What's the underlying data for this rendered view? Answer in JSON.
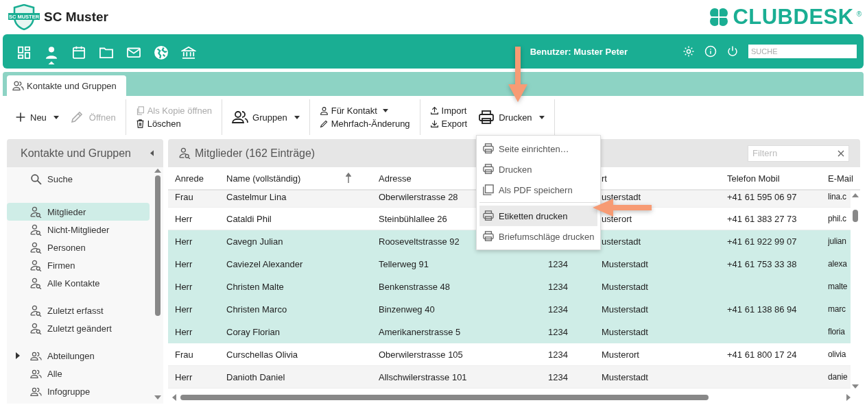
{
  "header": {
    "club_name": "SC Muster",
    "logo_text": "SC MUSTER",
    "brand": "CLUBDESK",
    "brand_mark": "®"
  },
  "nav": {
    "items": [
      {
        "selected": false
      },
      {
        "selected": true
      },
      {
        "selected": false
      },
      {
        "selected": false
      },
      {
        "selected": false
      },
      {
        "selected": false
      },
      {
        "selected": false
      }
    ],
    "user": "Benutzer: Muster Peter",
    "search": {
      "placeholder": "SUCHE"
    }
  },
  "tabs": [
    {
      "label": "Kontakte und Gruppen",
      "selected": true
    }
  ],
  "toolbar": {
    "new": {
      "label": "Neu",
      "disabled": false
    },
    "open": {
      "label": "Öffnen",
      "disabled": true
    },
    "copy": {
      "label": "Als Kopie öffnen",
      "disabled": true
    },
    "delete": {
      "label": "Löschen",
      "disabled": false
    },
    "groups": {
      "label": "Gruppen",
      "disabled": false
    },
    "for_contact": {
      "label": "Für Kontakt",
      "disabled": false
    },
    "bulk_edit": {
      "label": "Mehrfach-Änderung",
      "disabled": false
    },
    "import": {
      "label": "Import",
      "disabled": false
    },
    "export": {
      "label": "Export",
      "disabled": false
    },
    "print": {
      "label": "Drucken",
      "disabled": false
    }
  },
  "sidebar": {
    "title": "Kontakte und Gruppen",
    "sections": [
      [
        {
          "kind": "search",
          "label": "Suche",
          "selected": false
        }
      ],
      [
        {
          "kind": "filter",
          "label": "Mitglieder",
          "selected": true
        },
        {
          "kind": "filter",
          "label": "Nicht-Mitglieder",
          "selected": false
        },
        {
          "kind": "filter",
          "label": "Personen",
          "selected": false
        },
        {
          "kind": "filter",
          "label": "Firmen",
          "selected": false
        },
        {
          "kind": "filter",
          "label": "Alle Kontakte",
          "selected": false
        }
      ],
      [
        {
          "kind": "filter",
          "label": "Zuletzt erfasst",
          "selected": false
        },
        {
          "kind": "filter",
          "label": "Zuletzt geändert",
          "selected": false
        }
      ],
      [
        {
          "kind": "group",
          "label": "Abteilungen",
          "selected": false,
          "expanded": false
        },
        {
          "kind": "group",
          "label": "Alle",
          "selected": false
        },
        {
          "kind": "group",
          "label": "Infogruppe",
          "selected": false
        }
      ]
    ]
  },
  "list": {
    "title": "Mitglieder (162 Einträge)",
    "filter": {
      "placeholder": "Filtern"
    },
    "columns": [
      "Anrede",
      "Name (vollständig)",
      "Adresse",
      "",
      "rt",
      "Telefon Mobil",
      "E-Mail"
    ],
    "rows": [
      {
        "salutation": "Frau",
        "name": "Castelmur Lina",
        "address": "Oberwilerstrasse 28",
        "city": "usterstadt",
        "phone": "+41 61 595 06 97",
        "email": "lina.c",
        "selected": false
      },
      {
        "salutation": "Herr",
        "name": "Cataldi Phil",
        "address": "Steinbühlallee 26",
        "city": "usterort",
        "phone": "+41 61 383 27 73",
        "email": "phil.c",
        "selected": false
      },
      {
        "salutation": "Herr",
        "name": "Cavegn Julian",
        "address": "Rooseveltstrasse 92",
        "city": "usterstadt",
        "phone": "+41 61 922 99 07",
        "email": "julian",
        "selected": true
      },
      {
        "salutation": "Herr",
        "name": "Caviezel Alexander",
        "address": "Tellerweg 91",
        "zip": "1234",
        "city": "Musterstadt",
        "phone": "+41 61 753 33 38",
        "email": "alexa",
        "selected": true
      },
      {
        "salutation": "Herr",
        "name": "Christen Malte",
        "address": "Benkenstrasse 48",
        "zip": "1234",
        "city": "Musterstadt",
        "email": "malte",
        "selected": true
      },
      {
        "salutation": "Herr",
        "name": "Christen Marco",
        "address": "Binzenweg 40",
        "zip": "1234",
        "city": "Musterstadt",
        "phone": "+41 61 138 86 94",
        "email": "marc",
        "selected": true
      },
      {
        "salutation": "Herr",
        "name": "Coray Florian",
        "address": "Amerikanerstrasse 5",
        "zip": "1234",
        "city": "Musterstadt",
        "email": "floria",
        "selected": true
      },
      {
        "salutation": "Frau",
        "name": "Curschellas Olivia",
        "address": "Oberwilerstrasse 105",
        "zip": "1234",
        "city": "Musterort",
        "phone": "+41 61 800 17 24",
        "email": "olivia",
        "selected": false
      },
      {
        "salutation": "Herr",
        "name": "Danioth Daniel",
        "address": "Allschwilerstrasse 101",
        "zip": "1234",
        "city": "Musterstadt",
        "email": "danie",
        "selected": false
      }
    ]
  },
  "print_menu": {
    "items": [
      {
        "label": "Seite einrichten…",
        "selected": false
      },
      {
        "label": "Drucken",
        "selected": false
      },
      {
        "label": "Als PDF speichern",
        "selected": false
      },
      {
        "label": "Etiketten drucken",
        "selected": true,
        "separator_before": true
      },
      {
        "label": "Briefumschläge drucken",
        "selected": false
      }
    ]
  }
}
